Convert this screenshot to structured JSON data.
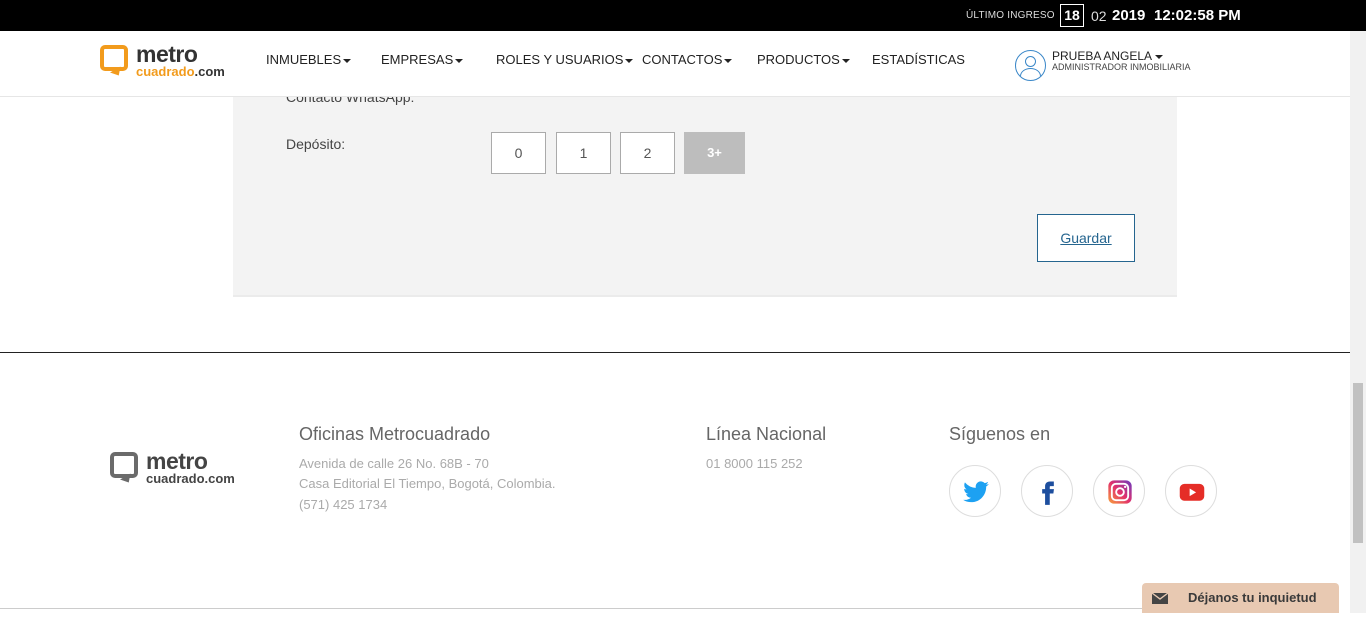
{
  "topbar": {
    "last_login_label": "ÚLTIMO INGRESO",
    "day": "18",
    "month": "02",
    "year": "2019",
    "time": "12:02:58 PM"
  },
  "brand": {
    "word_main": "metro",
    "word_sub_1": "cuadrado",
    "word_sub_2": ".com",
    "accent_color": "#f29b1c"
  },
  "nav": {
    "items": [
      {
        "label": "INMUEBLES",
        "dropdown": true
      },
      {
        "label": "EMPRESAS",
        "dropdown": true
      },
      {
        "label": "ROLES Y USUARIOS",
        "dropdown": true
      },
      {
        "label": "CONTACTOS",
        "dropdown": true
      },
      {
        "label": "PRODUCTOS",
        "dropdown": true
      },
      {
        "label": "ESTADÍSTICAS",
        "dropdown": false
      }
    ]
  },
  "user": {
    "name": "PRUEBA ANGELA",
    "role": "ADMINISTRADOR INMOBILIARIA",
    "icon": "user-avatar-icon"
  },
  "form": {
    "whatsapp_label": "Contacto WhatsApp:",
    "deposit_label": "Depósito:",
    "deposit_options": [
      "0",
      "1",
      "2",
      "3+"
    ],
    "deposit_selected": "3+",
    "save_label": "Guardar"
  },
  "footer": {
    "offices_title": "Oficinas Metrocuadrado",
    "address_line1": "Avenida de calle 26 No. 68B - 70",
    "address_line2": "Casa Editorial El Tiempo, Bogotá, Colombia.",
    "phone": "(571) 425 1734",
    "national_title": "Línea Nacional",
    "national_phone": "01 8000 115 252",
    "follow_title": "Síguenos en",
    "social": [
      "twitter-icon",
      "facebook-icon",
      "instagram-icon",
      "youtube-icon"
    ]
  },
  "feedback": {
    "label": "Déjanos tu inquietud",
    "icon": "envelope-icon"
  }
}
